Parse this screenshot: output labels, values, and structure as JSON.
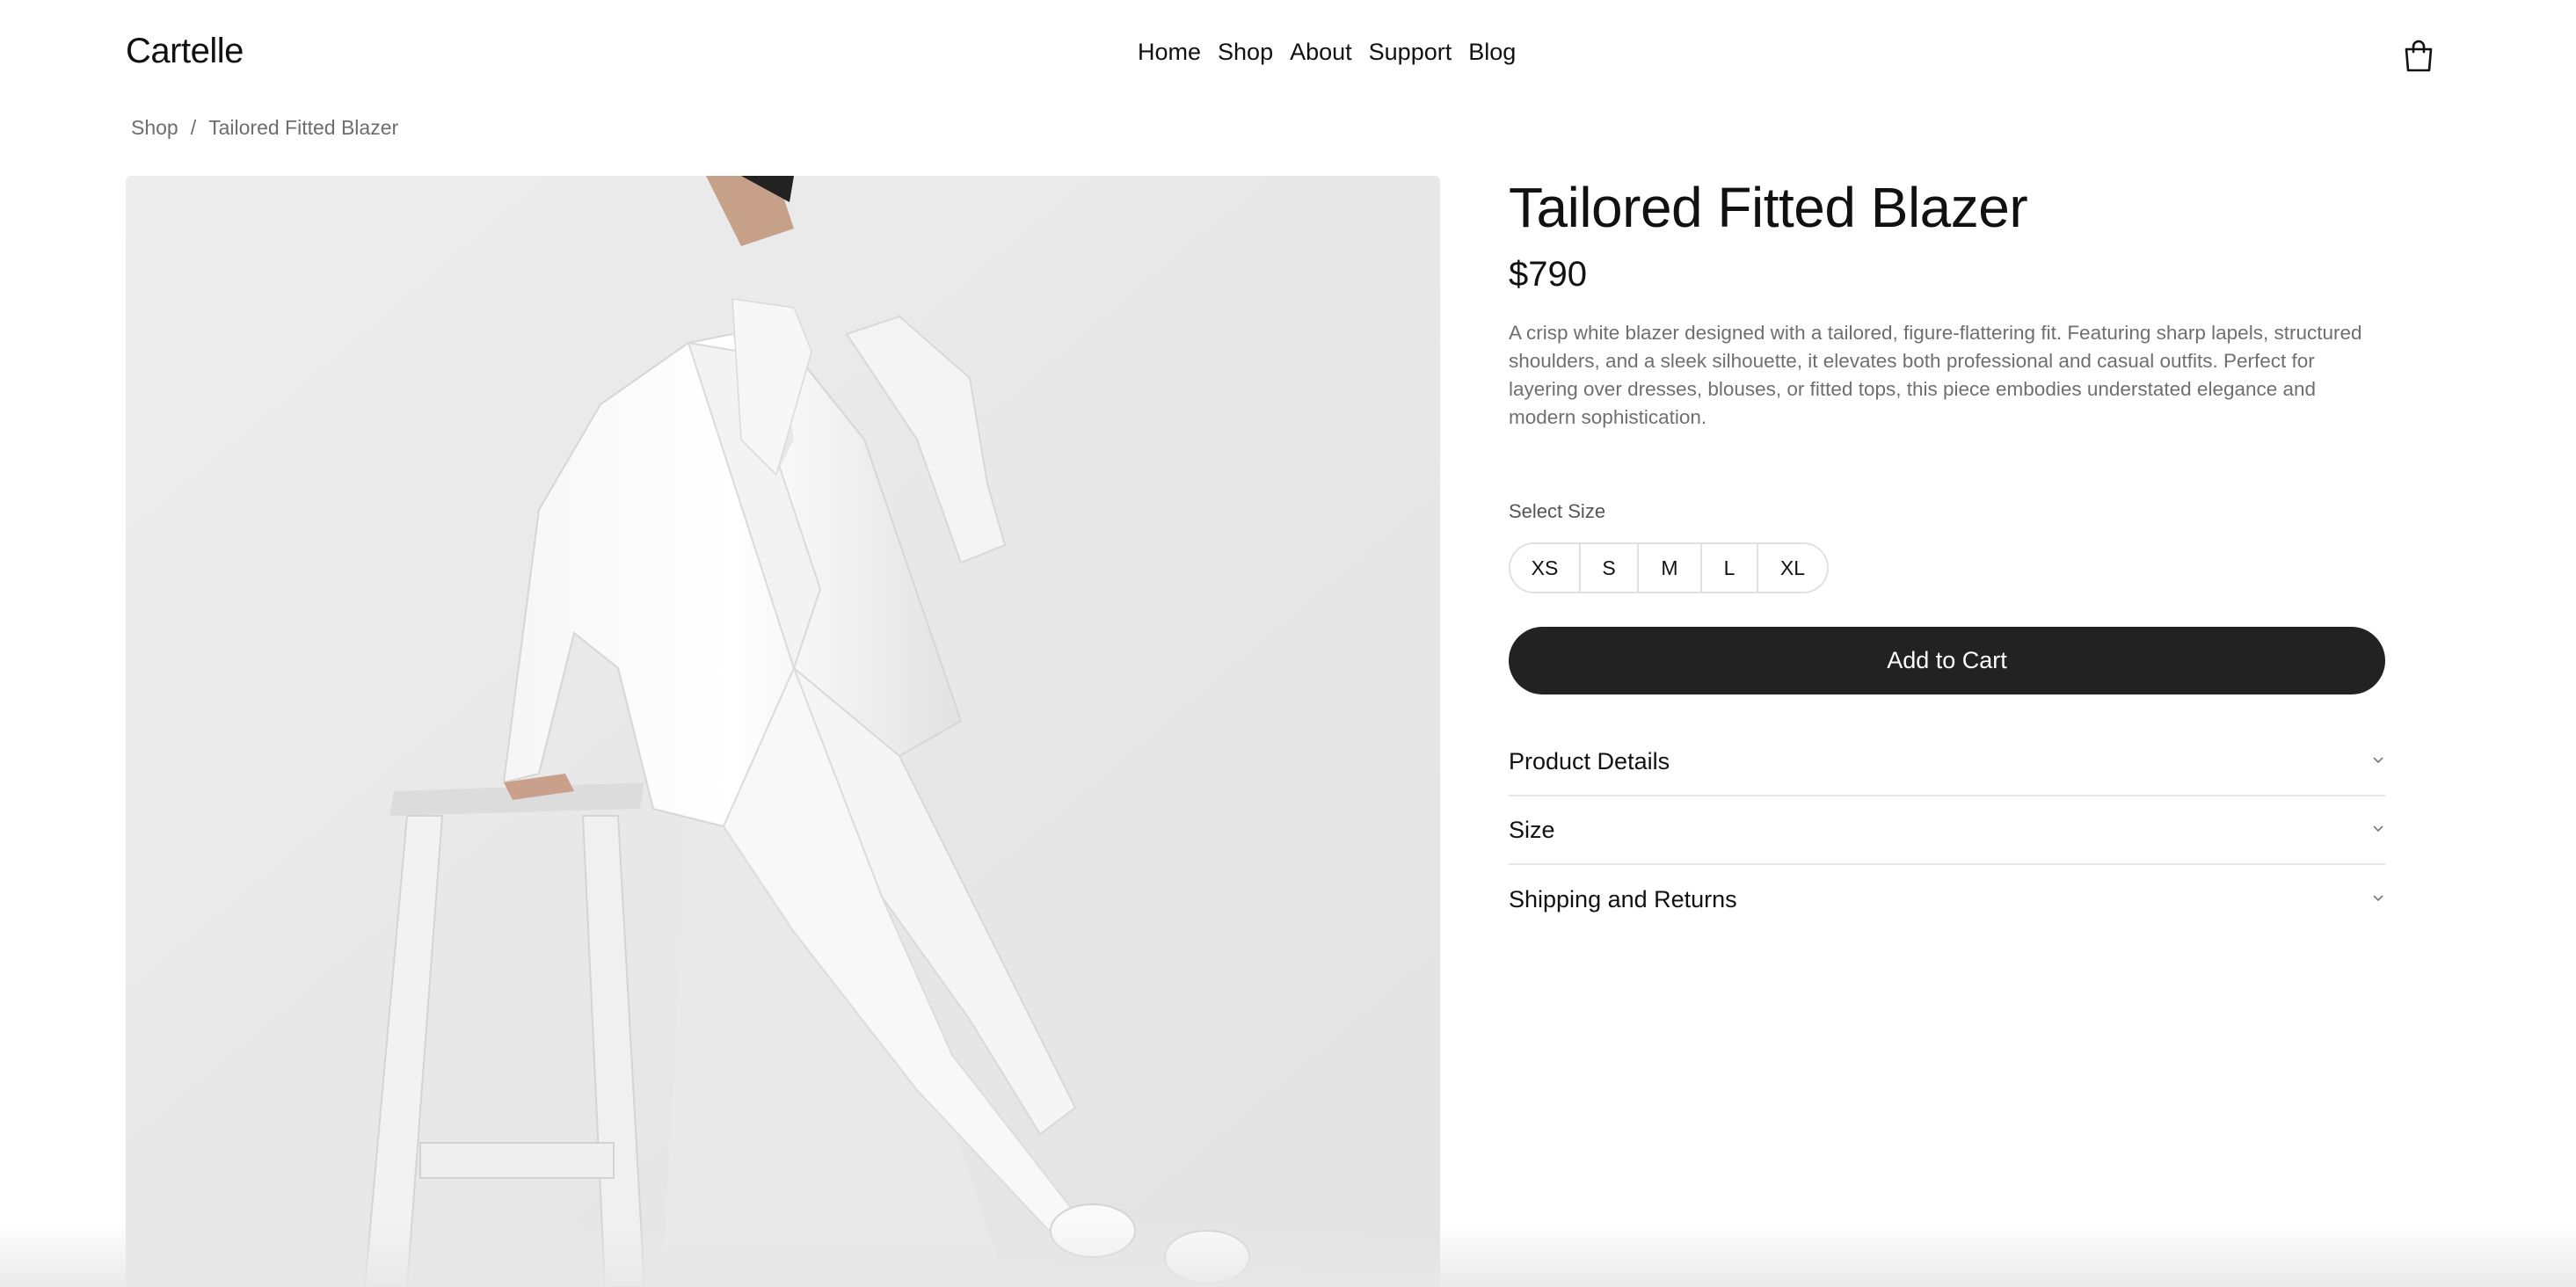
{
  "brand": {
    "logo_text": "Cartelle"
  },
  "nav": {
    "items": [
      {
        "label": "Home"
      },
      {
        "label": "Shop"
      },
      {
        "label": "About"
      },
      {
        "label": "Support"
      },
      {
        "label": "Blog"
      }
    ]
  },
  "header": {
    "cart_icon": "shopping-bag-icon"
  },
  "breadcrumb": {
    "items": [
      {
        "label": "Shop"
      },
      {
        "label": "Tailored Fitted Blazer"
      }
    ],
    "separator": "/"
  },
  "product": {
    "title": "Tailored Fitted Blazer",
    "price": "$790",
    "description": "A crisp white blazer designed with a tailored, figure-flattering fit. Featuring sharp lapels, structured shoulders, and a sleek silhouette, it elevates both professional and casual outfits. Perfect for layering over dresses, blouses, or fitted tops, this piece embodies understated elegance and modern sophistication.",
    "size_label": "Select Size",
    "sizes": [
      "XS",
      "S",
      "M",
      "L",
      "XL"
    ],
    "add_to_cart_label": "Add to Cart"
  },
  "accordion": {
    "items": [
      {
        "title": "Product Details"
      },
      {
        "title": "Size"
      },
      {
        "title": "Shipping and Returns"
      }
    ],
    "icon": "chevron-down-icon"
  },
  "colors": {
    "button_bg": "#222222",
    "text_muted": "#6f6f6f",
    "border": "#e1e1e1"
  }
}
